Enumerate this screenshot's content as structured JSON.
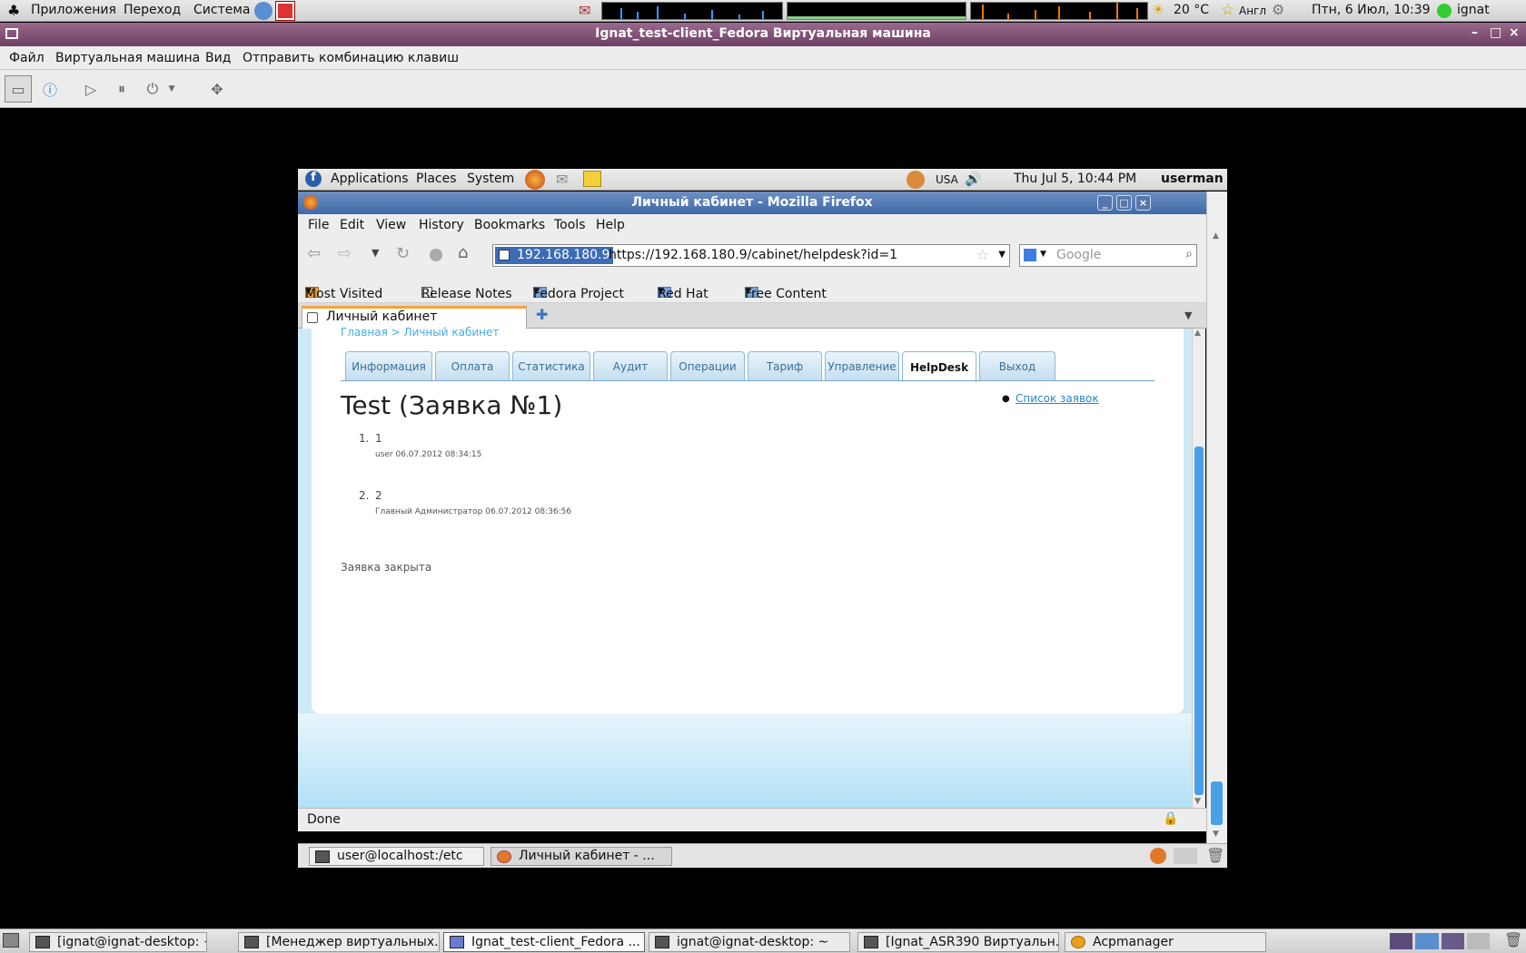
{
  "host_panel": {
    "apps": "Приложения",
    "places": "Переход",
    "system": "Система",
    "weather": "20 °C",
    "layout": "Англ",
    "clock": "Птн,  6 Июл, 10:39",
    "user": "ignat"
  },
  "vm": {
    "title": "Ignat_test-client_Fedora Виртуальная машина",
    "menu": [
      "Файл",
      "Виртуальная машина",
      "Вид",
      "Отправить комбинацию клавиш"
    ]
  },
  "guest_panel": {
    "menu": [
      "Applications",
      "Places",
      "System"
    ],
    "kbd": "USA",
    "clock": "Thu Jul  5, 10:44 PM",
    "user": "userman"
  },
  "firefox": {
    "title": "Личный кабинет - Mozilla Firefox",
    "menu": [
      "File",
      "Edit",
      "View",
      "History",
      "Bookmarks",
      "Tools",
      "Help"
    ],
    "url_host": "192.168.180.9",
    "url": "https://192.168.180.9/cabinet/helpdesk?id=1",
    "search_placeholder": "Google",
    "bookmarks": [
      "Most Visited",
      "Release Notes",
      "Fedora Project",
      "Red Hat",
      "Free Content"
    ],
    "tab": "Личный кабинет",
    "status": "Done"
  },
  "page": {
    "breadcrumb": "Главная > Личный кабинет",
    "tabs": [
      "Информация",
      "Оплата",
      "Статистика",
      "Аудит",
      "Операции",
      "Тариф",
      "Управление",
      "HelpDesk",
      "Выход"
    ],
    "active_tab": "HelpDesk",
    "heading": "Test (Заявка №1)",
    "side_link": "Список заявок",
    "messages": [
      {
        "num": "1.",
        "text": "1",
        "meta": "user 06.07.2012 08:34:15"
      },
      {
        "num": "2.",
        "text": "2",
        "meta": "Главный Администратор 06.07.2012 08:36:56"
      }
    ],
    "closed": "Заявка закрыта"
  },
  "guest_taskbar": [
    "user@localhost:/etc",
    "Личный кабинет - ..."
  ],
  "host_taskbar": [
    "[ignat@ignat-desktop: ~]",
    "[Менеджер виртуальных...",
    "Ignat_test-client_Fedora ...",
    "ignat@ignat-desktop: ~",
    "[Ignat_ASR390 Виртуальн...",
    "Acpmanager"
  ]
}
